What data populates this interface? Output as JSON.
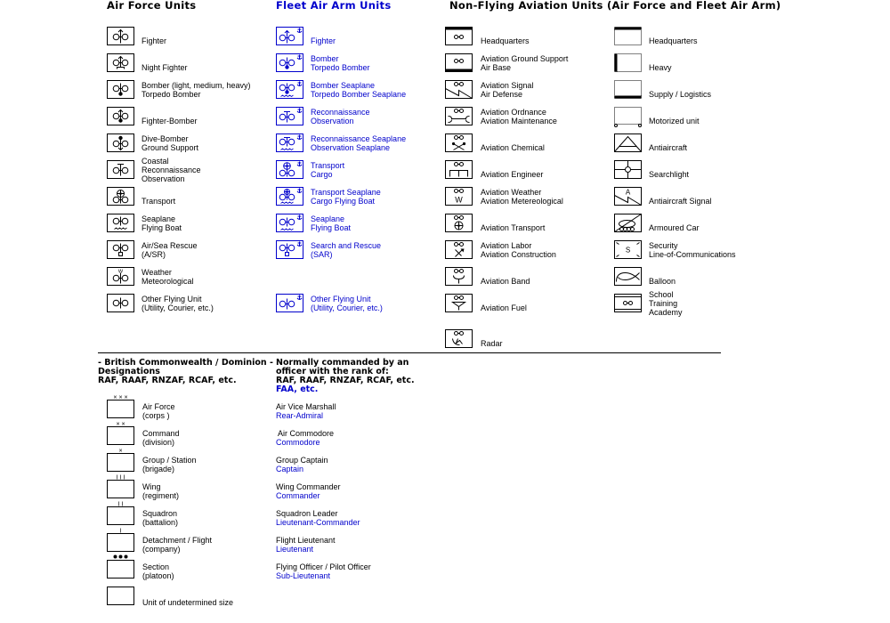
{
  "headings": {
    "air_force": "Air Force Units",
    "fleet_air_arm": "Fleet Air Arm Units",
    "non_flying": "Non-Flying Aviation Units  (Air Force and Fleet Air Arm)"
  },
  "colors": {
    "text": "#000000",
    "fleet_air_arm": "#0000cc"
  },
  "air_force_units": [
    {
      "icon": "fighter-icon",
      "lines": [
        "Fighter"
      ]
    },
    {
      "icon": "night-fighter-icon",
      "lines": [
        "Night Fighter"
      ]
    },
    {
      "icon": "bomber-icon",
      "lines": [
        "Bomber (light, medium, heavy)",
        "Torpedo Bomber"
      ]
    },
    {
      "icon": "fighter-bomber-icon",
      "lines": [
        "Fighter-Bomber"
      ]
    },
    {
      "icon": "dive-bomber-icon",
      "lines": [
        "Dive-Bomber",
        "Ground Support"
      ]
    },
    {
      "icon": "reconnaissance-icon",
      "lines": [
        "Coastal",
        "Reconnaissance",
        "Observation"
      ]
    },
    {
      "icon": "transport-icon",
      "lines": [
        "Transport"
      ]
    },
    {
      "icon": "seaplane-icon",
      "lines": [
        "Seaplane",
        "Flying Boat"
      ]
    },
    {
      "icon": "air-sea-rescue-icon",
      "lines": [
        "Air/Sea Rescue",
        "(A/SR)"
      ]
    },
    {
      "icon": "weather-icon",
      "lines": [
        "Weather",
        "Meteorological"
      ]
    },
    {
      "icon": "other-flying-unit-icon",
      "lines": [
        "Other Flying Unit",
        "(Utility, Courier, etc.)"
      ]
    }
  ],
  "fleet_air_arm_units": [
    {
      "icon": "faa-fighter-icon",
      "lines": [
        "Fighter"
      ]
    },
    {
      "icon": "faa-bomber-icon",
      "lines": [
        "Bomber",
        "Torpedo Bomber"
      ]
    },
    {
      "icon": "faa-bomber-seaplane-icon",
      "lines": [
        "Bomber Seaplane",
        "Torpedo Bomber Seaplane"
      ]
    },
    {
      "icon": "faa-reconnaissance-icon",
      "lines": [
        "Reconnaissance",
        "Observation"
      ]
    },
    {
      "icon": "faa-reconnaissance-seaplane-icon",
      "lines": [
        "Reconnaissance Seaplane",
        "Observation Seaplane"
      ]
    },
    {
      "icon": "faa-transport-icon",
      "lines": [
        "Transport",
        "Cargo"
      ]
    },
    {
      "icon": "faa-transport-seaplane-icon",
      "lines": [
        "Transport Seaplane",
        "Cargo Flying Boat"
      ]
    },
    {
      "icon": "faa-seaplane-icon",
      "lines": [
        "Seaplane",
        "Flying Boat"
      ]
    },
    {
      "icon": "faa-search-rescue-icon",
      "lines": [
        "Search and Rescue",
        "(SAR)"
      ]
    },
    {
      "icon": "faa-other-flying-unit-icon",
      "lines": [
        "Other Flying Unit",
        "(Utility, Courier, etc.)"
      ]
    }
  ],
  "non_flying_units_a": [
    {
      "icon": "headquarters-icon",
      "lines": [
        "Headquarters"
      ]
    },
    {
      "icon": "ground-support-icon",
      "lines": [
        "Aviation Ground Support",
        "Air Base"
      ]
    },
    {
      "icon": "aviation-signal-icon",
      "lines": [
        "Aviation Signal",
        "Air Defense"
      ]
    },
    {
      "icon": "aviation-ordnance-icon",
      "lines": [
        "Aviation Ordnance",
        "Aviation Maintenance"
      ]
    },
    {
      "icon": "aviation-chemical-icon",
      "lines": [
        "Aviation Chemical"
      ]
    },
    {
      "icon": "aviation-engineer-icon",
      "lines": [
        "Aviation Engineer"
      ]
    },
    {
      "icon": "aviation-weather-icon",
      "lines": [
        "Aviation Weather",
        "Aviation Metereological"
      ]
    },
    {
      "icon": "aviation-transport-icon",
      "lines": [
        "Aviation Transport"
      ]
    },
    {
      "icon": "aviation-labor-icon",
      "lines": [
        "Aviation Labor",
        "Aviation Construction"
      ]
    },
    {
      "icon": "aviation-band-icon",
      "lines": [
        "Aviation Band"
      ]
    },
    {
      "icon": "aviation-fuel-icon",
      "lines": [
        "Aviation Fuel"
      ]
    },
    {
      "icon": "radar-icon",
      "lines": [
        "Radar"
      ]
    }
  ],
  "non_flying_units_b": [
    {
      "icon": "hq-modifier-icon",
      "lines": [
        "Headquarters"
      ]
    },
    {
      "icon": "heavy-modifier-icon",
      "lines": [
        "Heavy"
      ]
    },
    {
      "icon": "supply-modifier-icon",
      "lines": [
        "Supply / Logistics"
      ]
    },
    {
      "icon": "motorized-modifier-icon",
      "lines": [
        "Motorized unit"
      ]
    },
    {
      "icon": "antiaircraft-icon",
      "lines": [
        "Antiaircraft"
      ]
    },
    {
      "icon": "searchlight-icon",
      "lines": [
        "Searchlight"
      ]
    },
    {
      "icon": "antiaircraft-signal-icon",
      "lines": [
        "Antiaircraft Signal"
      ]
    },
    {
      "icon": "armoured-car-icon",
      "lines": [
        "Armoured Car"
      ]
    },
    {
      "icon": "security-icon",
      "lines": [
        "Security",
        "Line-of-Communications"
      ]
    },
    {
      "icon": "balloon-icon",
      "lines": [
        "Balloon"
      ]
    },
    {
      "icon": "school-icon",
      "lines": [
        "School",
        "Training",
        "Academy"
      ]
    }
  ],
  "designations": {
    "heading_lines": [
      "- British Commonwealth / Dominion -",
      "Designations",
      "RAF, RAAF, RNZAF, RCAF, etc."
    ],
    "rank_heading_lines": [
      "Normally commanded by an",
      "officer with the rank of:",
      "RAF, RAAF, RNZAF, RCAF, etc."
    ],
    "rank_heading_faa": "FAA, etc.",
    "sizes": [
      {
        "marker": "xxx",
        "lines": [
          "Air Force",
          "(corps )"
        ],
        "raf_rank": "Air Vice Marshall",
        "faa_rank": "Rear-Admiral"
      },
      {
        "marker": "xx",
        "lines": [
          "Command",
          "(division)"
        ],
        "raf_rank": " Air Commodore",
        "faa_rank": "Commodore"
      },
      {
        "marker": "x",
        "lines": [
          "Group  /  Station",
          "(brigade)"
        ],
        "raf_rank": "Group Captain",
        "faa_rank": "Captain"
      },
      {
        "marker": "iii",
        "lines": [
          "Wing",
          "(regiment)"
        ],
        "raf_rank": "Wing Commander",
        "faa_rank": "Commander"
      },
      {
        "marker": "ii",
        "lines": [
          "Squadron",
          "(battalion)"
        ],
        "raf_rank": "Squadron Leader",
        "faa_rank": "Lieutenant-Commander"
      },
      {
        "marker": "i",
        "lines": [
          "Detachment  /  Flight",
          "(company)"
        ],
        "raf_rank": "Flight Lieutenant",
        "faa_rank": "Lieutenant"
      },
      {
        "marker": "dots",
        "lines": [
          "Section",
          "(platoon)"
        ],
        "raf_rank": "Flying Officer / Pilot Officer",
        "faa_rank": "Sub-Lieutenant"
      },
      {
        "marker": "none",
        "lines": [
          "",
          "Unit of undetermined size"
        ],
        "raf_rank": "",
        "faa_rank": ""
      }
    ]
  }
}
